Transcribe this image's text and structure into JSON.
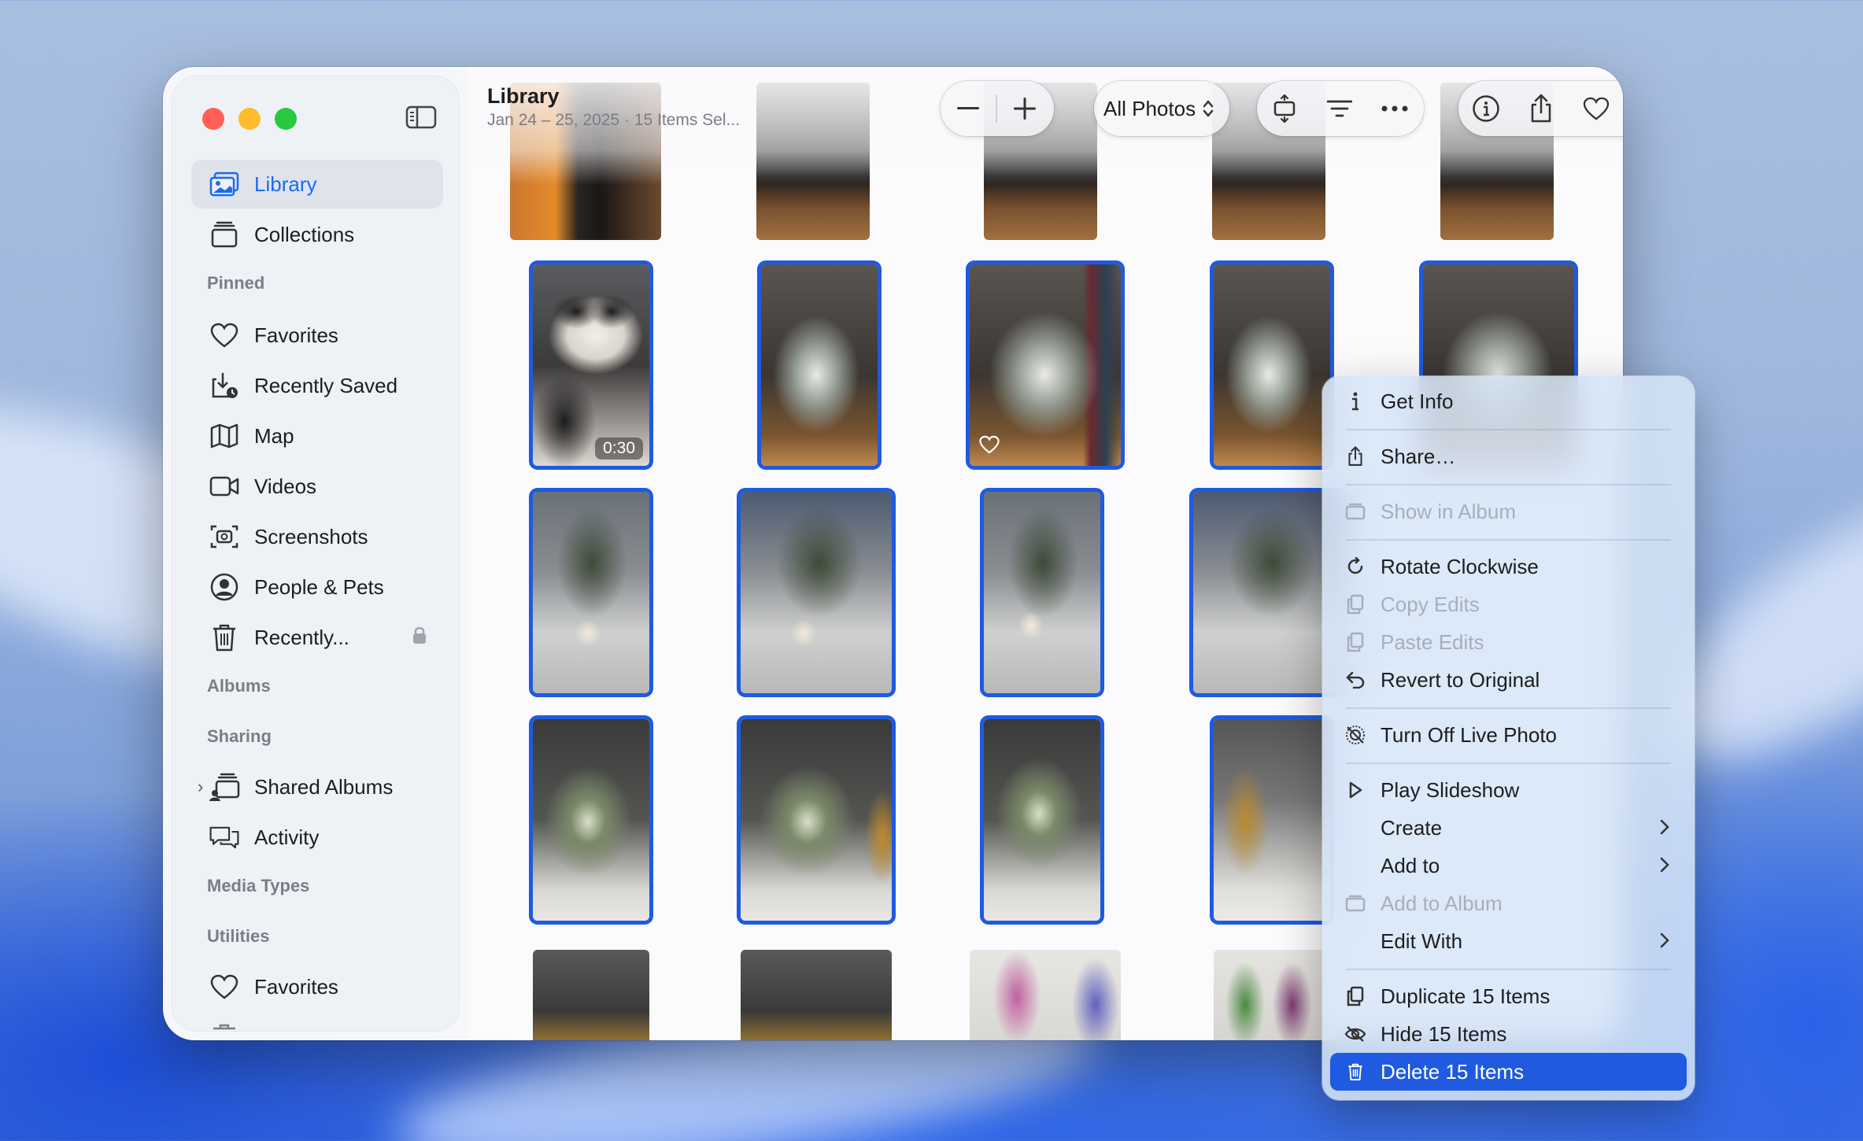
{
  "sidebar": {
    "items": [
      {
        "label": "Library",
        "icon": "library-icon",
        "active": true
      },
      {
        "label": "Collections",
        "icon": "collections-icon"
      }
    ],
    "sections": {
      "pinned": "Pinned",
      "albums": "Albums",
      "sharing": "Sharing",
      "media_types": "Media Types",
      "utilities": "Utilities"
    },
    "pinned_items": [
      {
        "label": "Favorites",
        "icon": "heart-icon"
      },
      {
        "label": "Recently Saved",
        "icon": "recently-saved-icon"
      },
      {
        "label": "Map",
        "icon": "map-icon"
      },
      {
        "label": "Videos",
        "icon": "video-icon"
      },
      {
        "label": "Screenshots",
        "icon": "screenshot-icon"
      },
      {
        "label": "People & Pets",
        "icon": "person-icon"
      },
      {
        "label": "Recently...",
        "icon": "trash-icon",
        "locked": true
      }
    ],
    "sharing_items": [
      {
        "label": "Shared Albums",
        "icon": "shared-albums-icon"
      },
      {
        "label": "Activity",
        "icon": "activity-icon"
      }
    ],
    "utilities_items": [
      {
        "label": "Favorites",
        "icon": "heart-icon"
      }
    ]
  },
  "header": {
    "title": "Library",
    "subtitle": "Jan 24 – 25, 2025 · 15 Items Sel..."
  },
  "toolbar": {
    "view_filter": "All Photos"
  },
  "grid": {
    "video_duration": "0:30"
  },
  "context_menu": {
    "get_info": "Get Info",
    "share": "Share…",
    "show_in_album": "Show in Album",
    "rotate_clockwise": "Rotate Clockwise",
    "copy_edits": "Copy Edits",
    "paste_edits": "Paste Edits",
    "revert_to_original": "Revert to Original",
    "turn_off_live_photo": "Turn Off Live Photo",
    "play_slideshow": "Play Slideshow",
    "create": "Create",
    "add_to": "Add to",
    "add_to_album": "Add to Album",
    "edit_with": "Edit With",
    "duplicate": "Duplicate 15 Items",
    "hide": "Hide 15 Items",
    "delete": "Delete 15 Items"
  },
  "colors": {
    "accent": "#1f5ae0",
    "selection": "#1f5ae0",
    "sidebar_active_text": "#1a6bf0"
  }
}
